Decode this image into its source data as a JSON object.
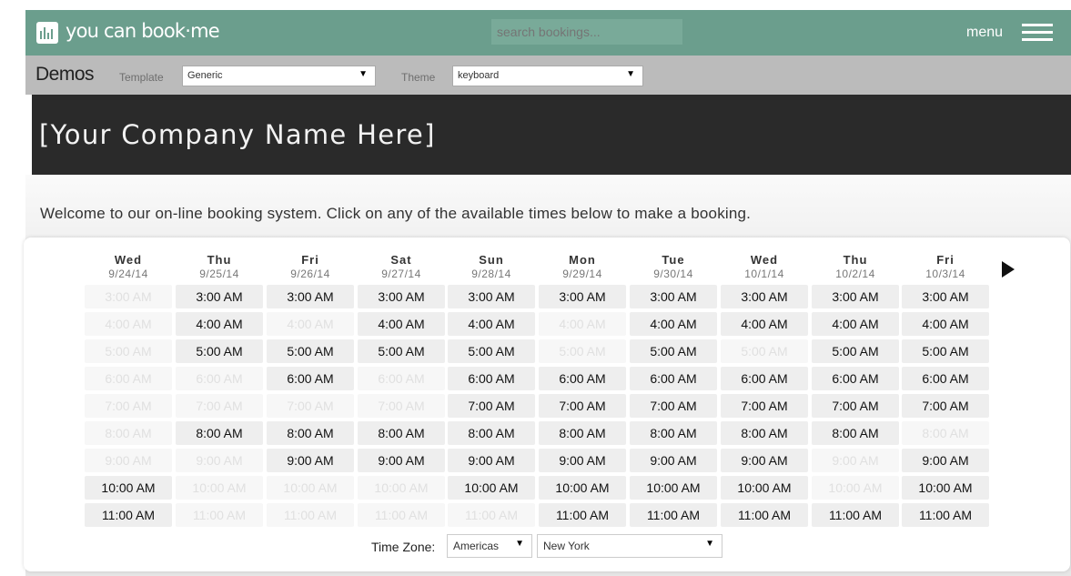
{
  "app": {
    "logo_text": "you can book·me"
  },
  "search": {
    "placeholder": "search bookings..."
  },
  "menu": {
    "label": "menu"
  },
  "demos": {
    "title": "Demos",
    "template_label": "Template",
    "template_value": "Generic",
    "theme_label": "Theme",
    "theme_value": "keyboard"
  },
  "company": {
    "name": "[Your Company Name Here]"
  },
  "welcome": "Welcome to our on-line booking system. Click on any of the available times below to make a booking.",
  "days": [
    {
      "name": "Wed",
      "date": "9/24/14"
    },
    {
      "name": "Thu",
      "date": "9/25/14"
    },
    {
      "name": "Fri",
      "date": "9/26/14"
    },
    {
      "name": "Sat",
      "date": "9/27/14"
    },
    {
      "name": "Sun",
      "date": "9/28/14"
    },
    {
      "name": "Mon",
      "date": "9/29/14"
    },
    {
      "name": "Tue",
      "date": "9/30/14"
    },
    {
      "name": "Wed",
      "date": "10/1/14"
    },
    {
      "name": "Thu",
      "date": "10/2/14"
    },
    {
      "name": "Fri",
      "date": "10/3/14"
    }
  ],
  "times": [
    "3:00 AM",
    "4:00 AM",
    "5:00 AM",
    "6:00 AM",
    "7:00 AM",
    "8:00 AM",
    "9:00 AM",
    "10:00 AM",
    "11:00 AM"
  ],
  "availability": [
    [
      0,
      1,
      1,
      1,
      1,
      1,
      1,
      1,
      1,
      1
    ],
    [
      0,
      1,
      0,
      1,
      1,
      0,
      1,
      1,
      1,
      1
    ],
    [
      0,
      1,
      1,
      1,
      1,
      0,
      1,
      0,
      1,
      1
    ],
    [
      0,
      0,
      1,
      0,
      1,
      1,
      1,
      1,
      1,
      1
    ],
    [
      0,
      0,
      0,
      0,
      1,
      1,
      1,
      1,
      1,
      1
    ],
    [
      0,
      1,
      1,
      1,
      1,
      1,
      1,
      1,
      1,
      0
    ],
    [
      0,
      0,
      1,
      1,
      1,
      1,
      1,
      1,
      0,
      1
    ],
    [
      1,
      0,
      0,
      0,
      1,
      1,
      1,
      1,
      0,
      1
    ],
    [
      1,
      0,
      0,
      0,
      0,
      1,
      1,
      1,
      1,
      1
    ]
  ],
  "timezone": {
    "label": "Time Zone:",
    "region": "Americas",
    "city": "New York"
  },
  "colors": {
    "topbar": "#6b9e8d",
    "demosbar": "#bbbbbb",
    "company_bg": "#2a2a2a",
    "slot_available": "#eeeeee",
    "slot_unavailable": "#f7f7f7"
  }
}
